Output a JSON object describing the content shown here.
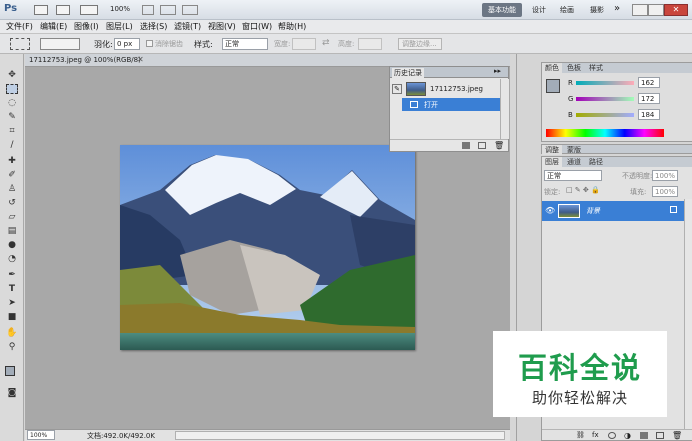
{
  "titlebar": {
    "logo": "Ps",
    "zoom": "100%",
    "workspace_active": "基本功能",
    "workspace_items": [
      "设计",
      "绘画",
      "摄影"
    ],
    "more": "»"
  },
  "menu": [
    "文件(F)",
    "编辑(E)",
    "图像(I)",
    "图层(L)",
    "选择(S)",
    "滤镜(T)",
    "视图(V)",
    "窗口(W)",
    "帮助(H)"
  ],
  "options": {
    "feather_label": "羽化:",
    "feather_value": "0 px",
    "antialias_label": "消除锯齿",
    "style_label": "样式:",
    "style_value": "正常",
    "width_label": "宽度:",
    "height_label": "高度:",
    "refine_label": "调整边缘..."
  },
  "document": {
    "tab_title": "17112753.jpeg @ 100%(RGB/8)",
    "zoom": "100%",
    "doc_info": "文档:492.0K/492.0K"
  },
  "history": {
    "title": "历史记录",
    "snapshot": "17112753.jpeg",
    "step": "打开"
  },
  "color": {
    "tabs": [
      "颜色",
      "色板",
      "样式"
    ],
    "r_label": "R",
    "g_label": "G",
    "b_label": "B",
    "r": "162",
    "g": "172",
    "b": "184",
    "fg": "#a2acb8"
  },
  "adjust": {
    "tabs": [
      "调整",
      "蒙版"
    ]
  },
  "layers": {
    "tabs": [
      "图层",
      "通道",
      "路径"
    ],
    "blend": "正常",
    "opacity_label": "不透明度:",
    "opacity": "100%",
    "lock_label": "锁定:",
    "fill_label": "填充:",
    "fill": "100%",
    "layer_name": "背景"
  },
  "watermark": {
    "title": "百科全说",
    "subtitle": "助你轻松解决",
    "title_color": "#1f9c4d"
  }
}
